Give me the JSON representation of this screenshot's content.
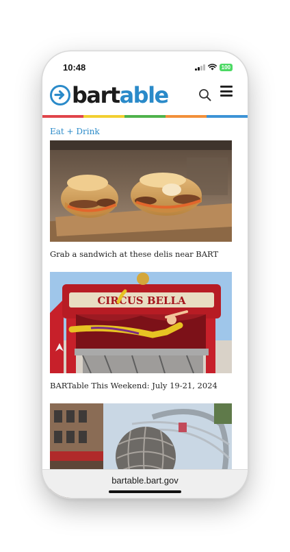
{
  "status_bar": {
    "time": "10:48",
    "battery": "100",
    "icons": [
      "signal-icon",
      "wifi-icon",
      "battery-icon"
    ]
  },
  "header": {
    "logo_part1": "bart",
    "logo_part2": "able",
    "icons": [
      "search-icon",
      "menu-icon"
    ],
    "stripe_colors": [
      "#e0454a",
      "#f2cf31",
      "#4fb24b",
      "#f2903a",
      "#3d93d6"
    ]
  },
  "content": {
    "category": "Eat + Drink",
    "articles": [
      {
        "title": "Grab a sandwich at these delis near BART",
        "image": "sandwich-photo"
      },
      {
        "title": "BARTable This Weekend: July 19-21, 2024",
        "image": "circus-photo"
      },
      {
        "title": "",
        "image": "sculpture-photo"
      }
    ]
  },
  "circus_sign": "CIRCUS BELLA",
  "browser": {
    "url": "bartable.bart.gov"
  },
  "colors": {
    "brand_blue": "#2a8ac9",
    "logo_dark": "#1c1c1c"
  }
}
